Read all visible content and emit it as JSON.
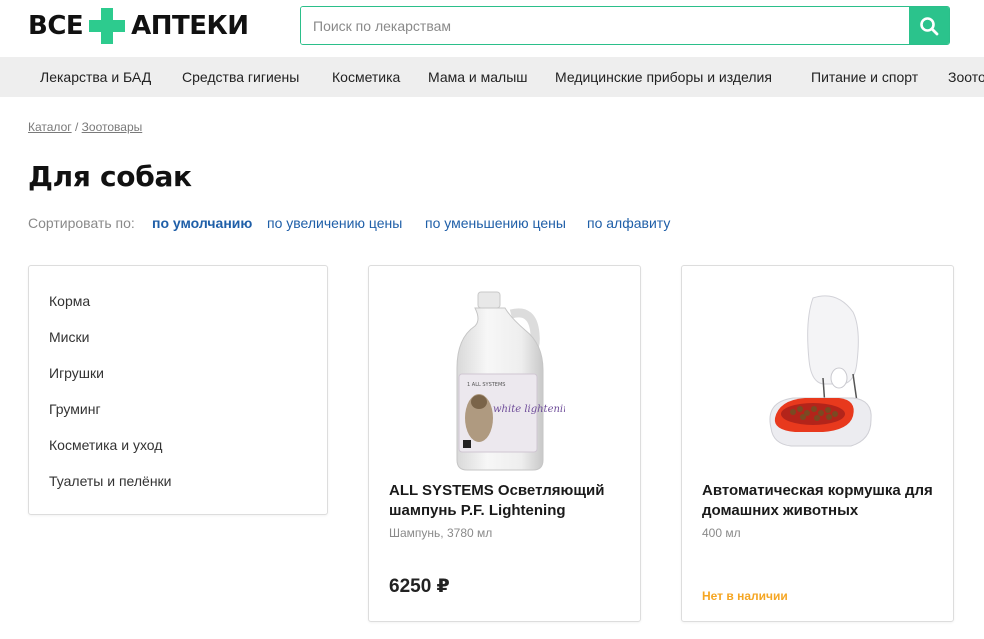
{
  "header": {
    "logo_left": "ВСЕ",
    "logo_right": "АПТЕКИ",
    "brand_color": "#2dcb8e",
    "search": {
      "placeholder": "Поиск по лекарствам",
      "value": "",
      "button_icon": "search-icon"
    }
  },
  "nav": {
    "items": [
      "Лекарства и БАД",
      "Средства гигиены",
      "Косметика",
      "Мама и малыш",
      "Медицинские приборы и изделия",
      "Питание и спорт",
      "Зоотовары"
    ]
  },
  "breadcrumb": {
    "items": [
      "Каталог",
      "Зоотовары"
    ],
    "separator": "/"
  },
  "page": {
    "title": "Для собак"
  },
  "sort": {
    "label": "Сортировать по:",
    "options": [
      "по умолчанию",
      "по увеличению цены",
      "по уменьшению цены",
      "по алфавиту"
    ],
    "active": "по умолчанию",
    "link_color": "#1f5fa8"
  },
  "sidebar": {
    "items": [
      "Корма",
      "Миски",
      "Игрушки",
      "Груминг",
      "Косметика и уход",
      "Туалеты и пелёнки"
    ]
  },
  "products": [
    {
      "title": "ALL SYSTEMS Осветляющий шампунь P.F. Lightening",
      "subtitle": "Шампунь, 3780 мл",
      "price": "6250 ₽",
      "image": "shampoo-bottle",
      "bottle_label": "white lightening",
      "bottle_brand": "1 ALL SYSTEMS"
    },
    {
      "title": "Автоматическая кормушка для домашних животных",
      "subtitle": "400 мл",
      "stock": "Нет в наличии",
      "stock_color": "#f5a623",
      "image": "pet-feeder"
    }
  ]
}
